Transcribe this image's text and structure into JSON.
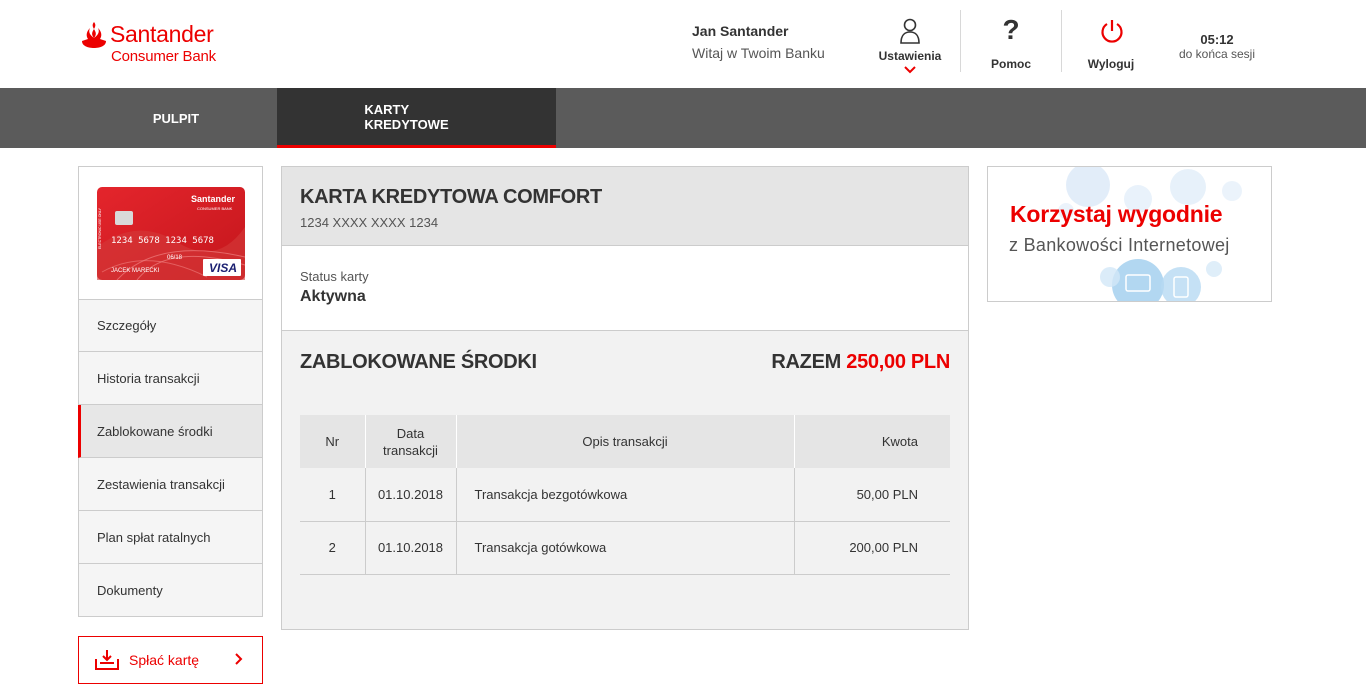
{
  "brand": {
    "name": "Santander",
    "sub": "Consumer Bank"
  },
  "user": {
    "name": "Jan Santander",
    "greeting": "Witaj w Twoim Banku"
  },
  "header": {
    "settings_label": "Ustawienia",
    "help_label": "Pomoc",
    "logout_label": "Wyloguj",
    "session_time": "05:12",
    "session_label": "do końca sesji",
    "help_glyph": "?"
  },
  "nav": {
    "tabs": [
      {
        "label": "PULPIT"
      },
      {
        "label": "KARTY\nKREDYTOWE"
      }
    ]
  },
  "card_image": {
    "brand": "Santander",
    "sub": "CONSUMER BANK",
    "number": "1234 5678 1234 5678",
    "expiry": "06/18",
    "holder": "JACEK MARECKI",
    "network": "VISA",
    "side_text": "ELECTRONIC USE ONLY"
  },
  "sidebar": {
    "items": [
      {
        "label": "Szczegóły"
      },
      {
        "label": "Historia transakcji"
      },
      {
        "label": "Zablokowane środki"
      },
      {
        "label": "Zestawienia transakcji"
      },
      {
        "label": "Plan spłat ratalnych"
      },
      {
        "label": "Dokumenty"
      }
    ],
    "pay_button": "Spłać kartę"
  },
  "main": {
    "card_title": "KARTA KREDYTOWA COMFORT",
    "card_number": "1234 XXXX XXXX 1234",
    "status_label": "Status karty",
    "status_value": "Aktywna",
    "blocked_title": "ZABLOKOWANE ŚRODKI",
    "total_label": "RAZEM",
    "total_amount": "250,00 PLN",
    "table": {
      "headers": {
        "nr": "Nr",
        "date": "Data transakcji",
        "desc": "Opis transakcji",
        "amount": "Kwota"
      },
      "rows": [
        {
          "nr": "1",
          "date": "01.10.2018",
          "desc": "Transakcja bezgotówkowa",
          "amount": "50,00 PLN"
        },
        {
          "nr": "2",
          "date": "01.10.2018",
          "desc": "Transakcja gotówkowa",
          "amount": "200,00 PLN"
        }
      ]
    }
  },
  "banner": {
    "line1": "Korzystaj wygodnie",
    "line2": "z Bankowości Internetowej"
  },
  "colors": {
    "accent": "#ec0000",
    "nav_bg": "#5b5b5b",
    "nav_active": "#333333"
  },
  "icons": {
    "settings": "user-icon",
    "help": "question-icon",
    "logout": "power-icon",
    "pay": "download-tray-icon"
  }
}
